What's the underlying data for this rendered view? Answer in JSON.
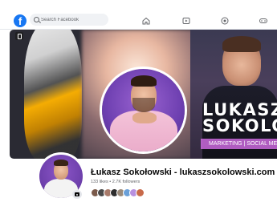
{
  "topbar": {
    "logo_glyph": "f",
    "search_placeholder": "Search Facebook",
    "nav_icons": [
      "home-icon",
      "video-icon",
      "marketplace-icon",
      "gaming-icon"
    ]
  },
  "cover": {
    "title_line1": "LUKASZ",
    "title_line2": "SOKOLO",
    "subtitle": "MARKETING | SOCIAL ME",
    "accent_color": "#cb6ade"
  },
  "profile": {
    "name": "Łukasz Sokołowski - lukaszsokolowski.com",
    "stats": "133 likes • 2.7K followers",
    "follower_avatar_colors": [
      "#7a5a4a",
      "#4a4a4a",
      "#a87a6a",
      "#2d2d2d",
      "#9a8a7a",
      "#6aa0d8",
      "#b891e0",
      "#c86a4a"
    ]
  },
  "colors": {
    "brand": "#1877f2",
    "text_primary": "#050505",
    "text_secondary": "#65676b"
  }
}
